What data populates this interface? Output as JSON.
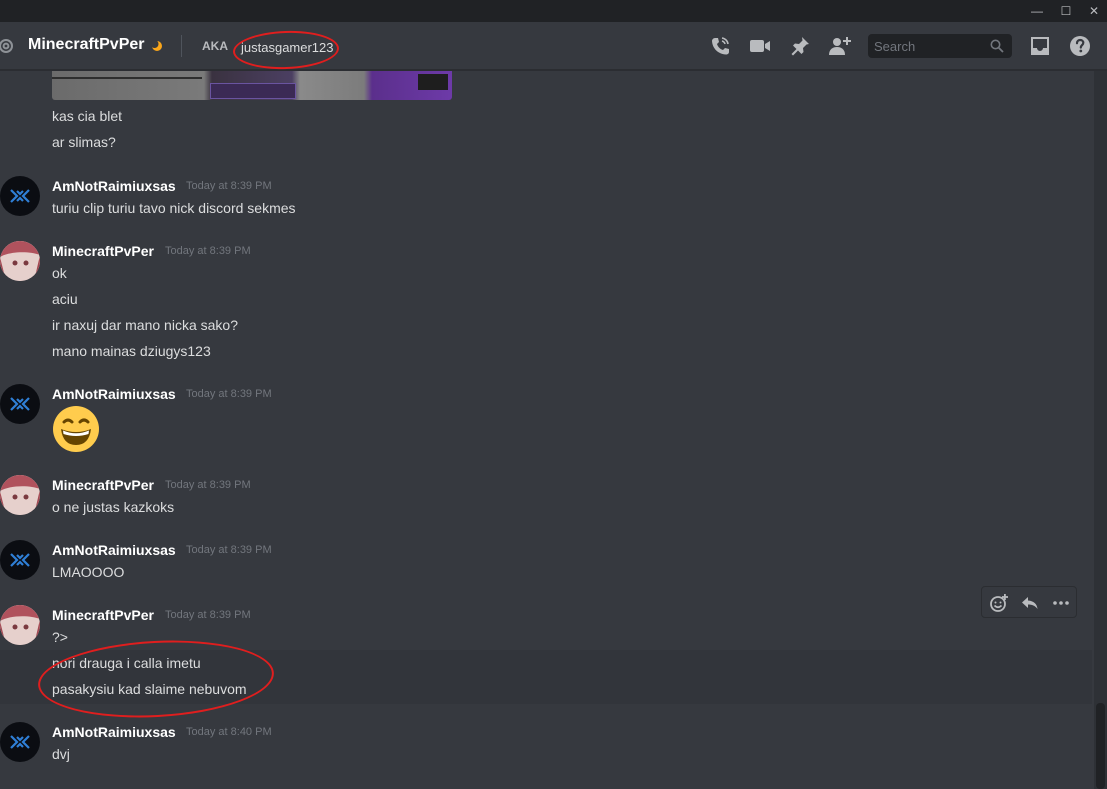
{
  "window": {
    "minimize_glyph": "—",
    "maximize_glyph": "☐",
    "close_glyph": "✕"
  },
  "header": {
    "channel_name": "MinecraftPvPer",
    "aka_label": "AKA",
    "aka_value": "justasgamer123",
    "search_placeholder": "Search",
    "icons": [
      "at-icon",
      "moon-icon",
      "call-icon",
      "video-icon",
      "pin-icon",
      "add-friend-icon",
      "search-icon",
      "inbox-icon",
      "help-icon"
    ]
  },
  "messages": {
    "top_lines": [
      "kas cia blet",
      "ar slimas?"
    ],
    "groups": [
      {
        "author": "AmNotRaimiuxsas",
        "timestamp": "Today at 8:39 PM",
        "lines": [
          "turiu clip turiu tavo nick discord sekmes"
        ]
      },
      {
        "author": "MinecraftPvPer",
        "timestamp": "Today at 8:39 PM",
        "lines": [
          "ok",
          "aciu",
          "ir naxuj dar mano nicka sako?",
          "mano mainas dziugys123"
        ]
      },
      {
        "author": "AmNotRaimiuxsas",
        "timestamp": "Today at 8:39 PM",
        "emoji": "grinning-emoji"
      },
      {
        "author": "MinecraftPvPer",
        "timestamp": "Today at 8:39 PM",
        "lines": [
          "o ne justas kazkoks"
        ]
      },
      {
        "author": "AmNotRaimiuxsas",
        "timestamp": "Today at 8:39 PM",
        "lines": [
          "LMAOOOO"
        ]
      },
      {
        "author": "MinecraftPvPer",
        "timestamp": "Today at 8:39 PM",
        "lines": [
          "?>",
          "nori drauga i calla imetu",
          "pasakysiu kad slaime nebuvom"
        ]
      },
      {
        "author": "AmNotRaimiuxsas",
        "timestamp": "Today at 8:40 PM",
        "lines": [
          "dvj"
        ]
      }
    ]
  },
  "colors": {
    "background": "#36393f",
    "titlebar": "#202225",
    "annotation": "#e01e1e",
    "username": "#ffffff",
    "timestamp": "#72767d"
  }
}
